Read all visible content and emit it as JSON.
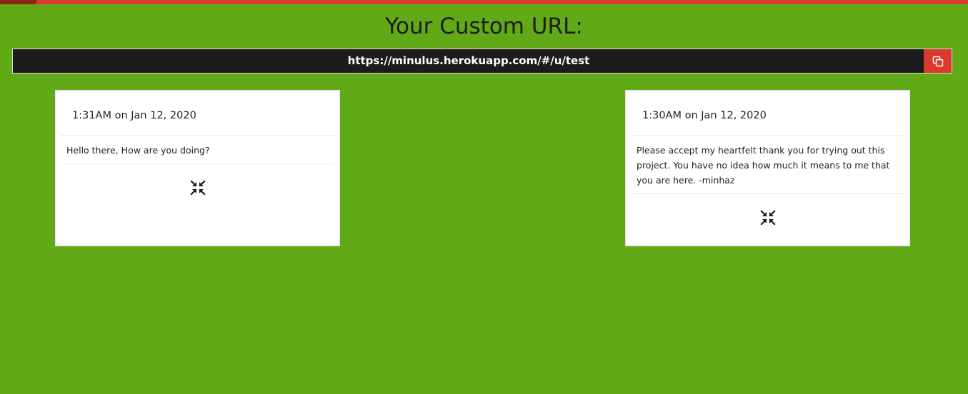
{
  "page": {
    "title": "Your Custom URL:",
    "url": "https://minulus.herokuapp.com/#/u/test",
    "copy_icon": "copy-icon"
  },
  "colors": {
    "background": "#61a917",
    "accent": "#d93a2b",
    "url_bar": "#1c1c1c",
    "card": "#ffffff"
  },
  "cards": [
    {
      "timestamp": "1:31AM on Jan 12, 2020",
      "message": "Hello there, How are you doing?",
      "action_icon": "collapse-arrows-icon"
    },
    {
      "timestamp": "1:30AM on Jan 12, 2020",
      "message": "Please accept my heartfelt thank you for trying out this project. You have no idea how much it means to me that you are here. -minhaz",
      "action_icon": "collapse-arrows-icon"
    }
  ]
}
